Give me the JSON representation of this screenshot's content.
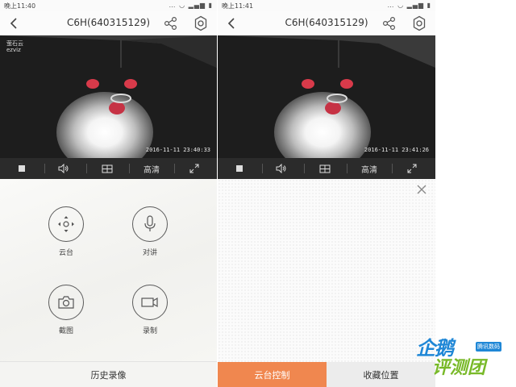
{
  "left_phone": {
    "statusbar": {
      "time": "晚上11:40",
      "icons": "… ◡ ▂▄▆ ▮"
    },
    "header": {
      "title": "C6H(640315129)",
      "back_icon": "chevron-left-icon",
      "share_icon": "share-icon",
      "settings_icon": "gear-icon"
    },
    "video": {
      "logo_line1": "萤石云",
      "logo_line2": "ezviz",
      "timestamp": "2016-11-11 23:40:33"
    },
    "controls": {
      "stop_icon": "stop-icon",
      "volume_icon": "speaker-icon",
      "layout_icon": "grid-icon",
      "quality_label": "高清",
      "fullscreen_icon": "expand-icon"
    },
    "functions": [
      {
        "label": "云台",
        "icon": "ptz-icon"
      },
      {
        "label": "对讲",
        "icon": "microphone-icon"
      },
      {
        "label": "截图",
        "icon": "camera-icon"
      },
      {
        "label": "录制",
        "icon": "video-record-icon"
      }
    ],
    "bottom_label": "历史录像"
  },
  "right_phone": {
    "statusbar": {
      "time": "晚上11:41",
      "icons": "… ◡ ▂▄▆ ▮"
    },
    "header": {
      "title": "C6H(640315129)",
      "back_icon": "chevron-left-icon",
      "share_icon": "share-icon",
      "settings_icon": "gear-icon"
    },
    "video": {
      "timestamp": "2016-11-11 23:41:26"
    },
    "controls": {
      "stop_icon": "stop-icon",
      "volume_icon": "speaker-icon",
      "layout_icon": "grid-icon",
      "quality_label": "高清",
      "fullscreen_icon": "expand-icon"
    },
    "close_icon": "close-icon",
    "tabs": [
      {
        "label": "云台控制",
        "active": true
      },
      {
        "label": "收藏位置",
        "active": false
      }
    ]
  },
  "watermark": {
    "line1": "企鹅",
    "line2": "评测团",
    "tag": "腾讯数码"
  },
  "colors": {
    "accent_orange": "#f0874f",
    "control_bar": "#2b2b2b",
    "watermark_blue": "#1f87d6",
    "watermark_green": "#78b928"
  }
}
